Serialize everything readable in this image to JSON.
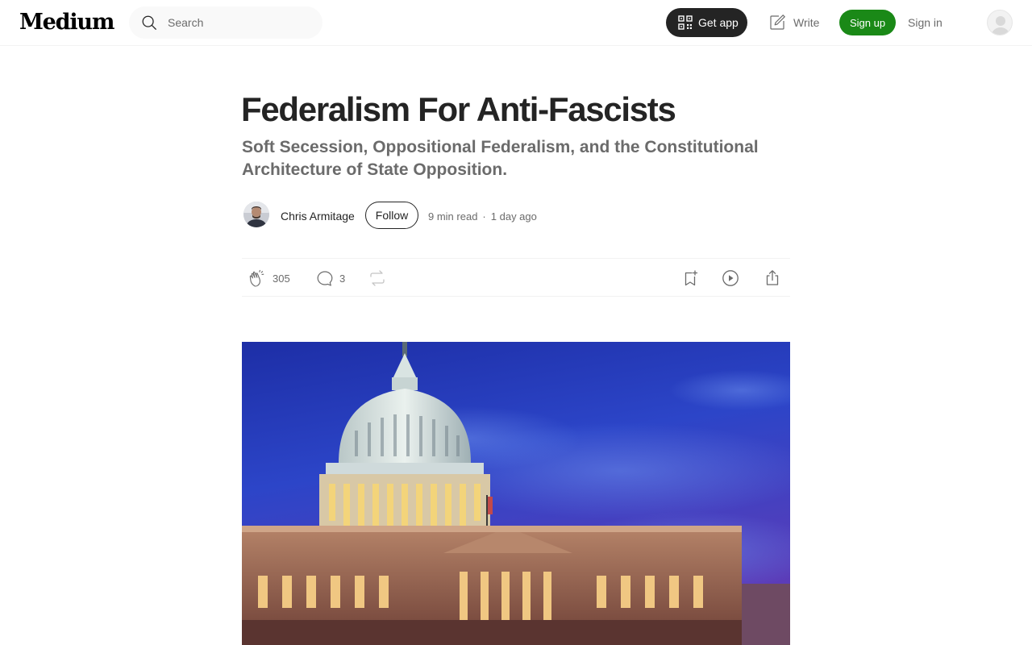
{
  "nav": {
    "logo": "Medium",
    "search_placeholder": "Search",
    "get_app_label": "Get app",
    "write_label": "Write",
    "sign_up_label": "Sign up",
    "sign_in_label": "Sign in"
  },
  "article": {
    "title": "Federalism For Anti-Fascists",
    "subtitle": "Soft Secession, Oppositional Federalism, and the Constitutional Architecture of State Opposition.",
    "author": "Chris Armitage",
    "follow_label": "Follow",
    "read_time": "9 min read",
    "separator": "·",
    "published": "1 day ago"
  },
  "actions": {
    "claps": "305",
    "responses": "3"
  },
  "icons": [
    "search-icon",
    "qr-code-icon",
    "write-icon",
    "user-avatar-icon",
    "clap-icon",
    "comment-icon",
    "repost-icon",
    "bookmark-add-icon",
    "play-icon",
    "share-icon"
  ],
  "colors": {
    "accent_green": "#1a8917",
    "text_primary": "#242424",
    "text_secondary": "#6b6b6b",
    "sky_blue": "#2a3fb8"
  }
}
